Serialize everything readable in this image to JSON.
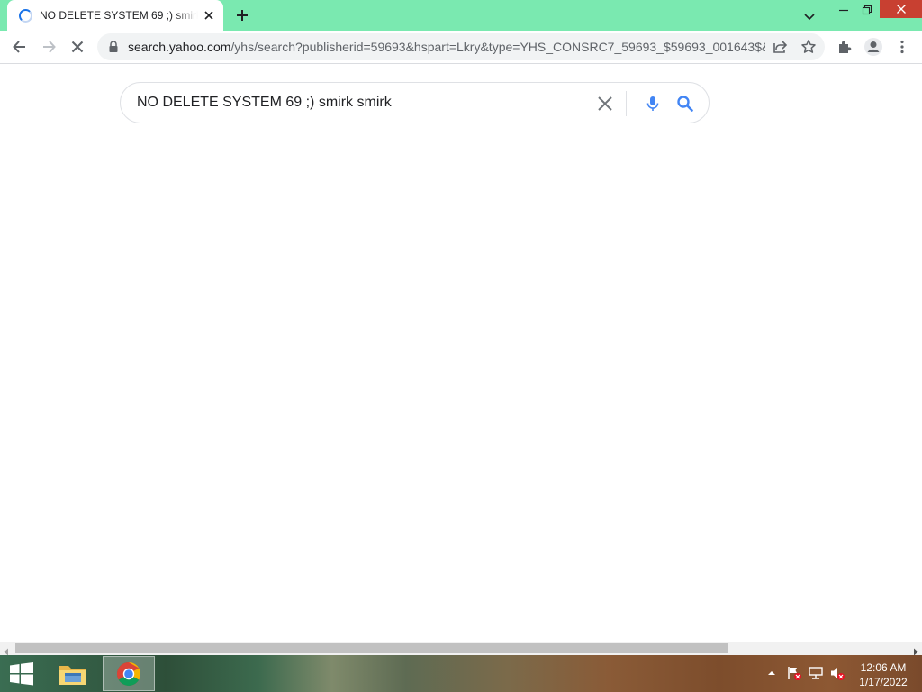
{
  "browser": {
    "tab": {
      "title": "NO DELETE SYSTEM 69 ;) smirk smirk"
    },
    "address_bar": {
      "host": "search.yahoo.com",
      "path": "/yhs/search?publisherid=59693&hspart=Lkry&type=YHS_CONSRC7_59693_$59693_001643$&..."
    }
  },
  "search": {
    "query": "NO DELETE SYSTEM 69 ;) smirk smirk"
  },
  "taskbar": {
    "time": "12:06 AM",
    "date": "1/17/2022"
  },
  "colors": {
    "tab_strip": "#7ae9b0",
    "close_button": "#c84031",
    "accent_blue": "#4285f4"
  }
}
